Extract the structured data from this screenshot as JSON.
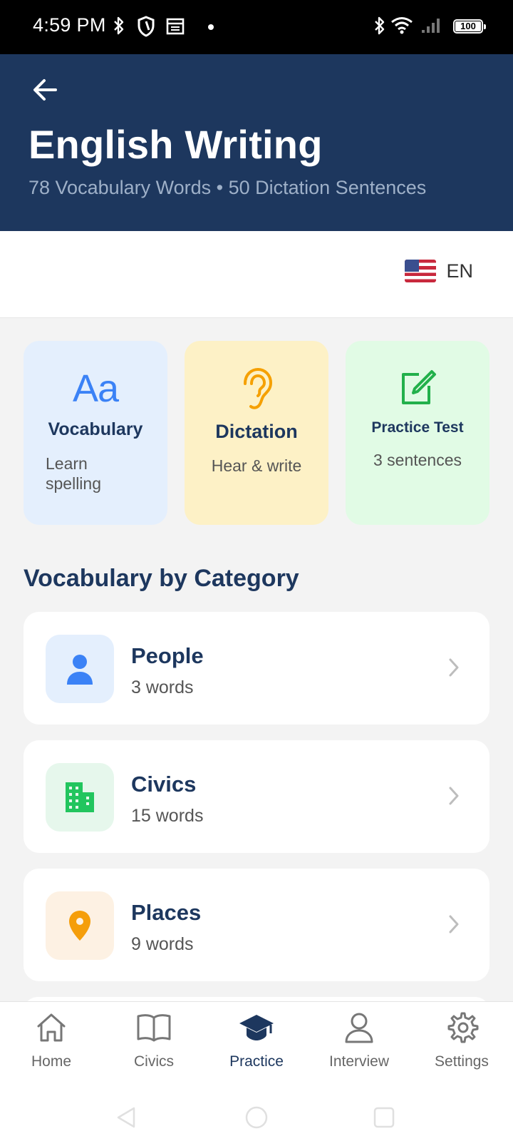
{
  "status_bar": {
    "time": "4:59 PM",
    "battery": "100"
  },
  "header": {
    "title": "English Writing",
    "subtitle": "78 Vocabulary Words • 50 Dictation Sentences"
  },
  "language": {
    "code": "EN"
  },
  "modes": [
    {
      "title": "Vocabulary",
      "description": "Learn spelling",
      "icon": "text-aa-icon",
      "color": "#3b82f6"
    },
    {
      "title": "Dictation",
      "description": "Hear & write",
      "icon": "ear-icon",
      "color": "#f5a000"
    },
    {
      "title": "Practice Test",
      "description": "3 sentences",
      "icon": "edit-square-icon",
      "color": "#22b04b"
    }
  ],
  "vocab_icon_text": "Aa",
  "section_title": "Vocabulary by Category",
  "categories": [
    {
      "name": "People",
      "count": "3 words",
      "icon": "person-icon",
      "color": "#3b82f6",
      "bg": "#e4effd"
    },
    {
      "name": "Civics",
      "count": "15 words",
      "icon": "building-icon",
      "color": "#22c55e",
      "bg": "#e6f7ec"
    },
    {
      "name": "Places",
      "count": "9 words",
      "icon": "location-pin-icon",
      "color": "#f59e0b",
      "bg": "#fdf1e3"
    }
  ],
  "nav": [
    {
      "label": "Home",
      "icon": "home-icon"
    },
    {
      "label": "Civics",
      "icon": "book-icon"
    },
    {
      "label": "Practice",
      "icon": "graduation-cap-icon",
      "active": true
    },
    {
      "label": "Interview",
      "icon": "user-icon"
    },
    {
      "label": "Settings",
      "icon": "gear-icon"
    }
  ],
  "colors": {
    "header_bg": "#1d375e",
    "accent": "#1d375e"
  }
}
